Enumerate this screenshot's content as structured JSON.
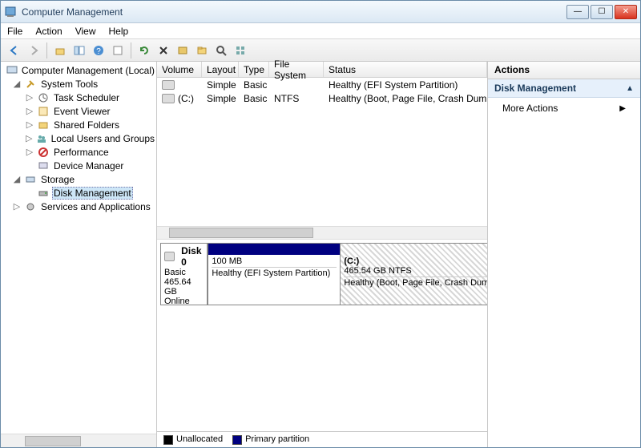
{
  "window": {
    "title": "Computer Management"
  },
  "menu": {
    "file": "File",
    "action": "Action",
    "view": "View",
    "help": "Help"
  },
  "tree": {
    "root": "Computer Management (Local)",
    "system_tools": "System Tools",
    "task_scheduler": "Task Scheduler",
    "event_viewer": "Event Viewer",
    "shared_folders": "Shared Folders",
    "local_users": "Local Users and Groups",
    "performance": "Performance",
    "device_manager": "Device Manager",
    "storage": "Storage",
    "disk_management": "Disk Management",
    "services_apps": "Services and Applications"
  },
  "vol_headers": {
    "volume": "Volume",
    "layout": "Layout",
    "type": "Type",
    "fs": "File System",
    "status": "Status"
  },
  "volumes": [
    {
      "name": "",
      "layout": "Simple",
      "type": "Basic",
      "fs": "",
      "status": "Healthy (EFI System Partition)"
    },
    {
      "name": "(C:)",
      "layout": "Simple",
      "type": "Basic",
      "fs": "NTFS",
      "status": "Healthy (Boot, Page File, Crash Dump"
    }
  ],
  "disk": {
    "label": "Disk 0",
    "type": "Basic",
    "size": "465.64 GB",
    "state": "Online",
    "parts": [
      {
        "name": "",
        "size": "100 MB",
        "status": "Healthy (EFI System Partition)"
      },
      {
        "name": "(C:)",
        "size": "465.54 GB NTFS",
        "status": "Healthy (Boot, Page File, Crash Dump"
      }
    ]
  },
  "legend": {
    "unalloc": "Unallocated",
    "primary": "Primary partition"
  },
  "actions": {
    "header": "Actions",
    "section": "Disk Management",
    "more": "More Actions"
  }
}
